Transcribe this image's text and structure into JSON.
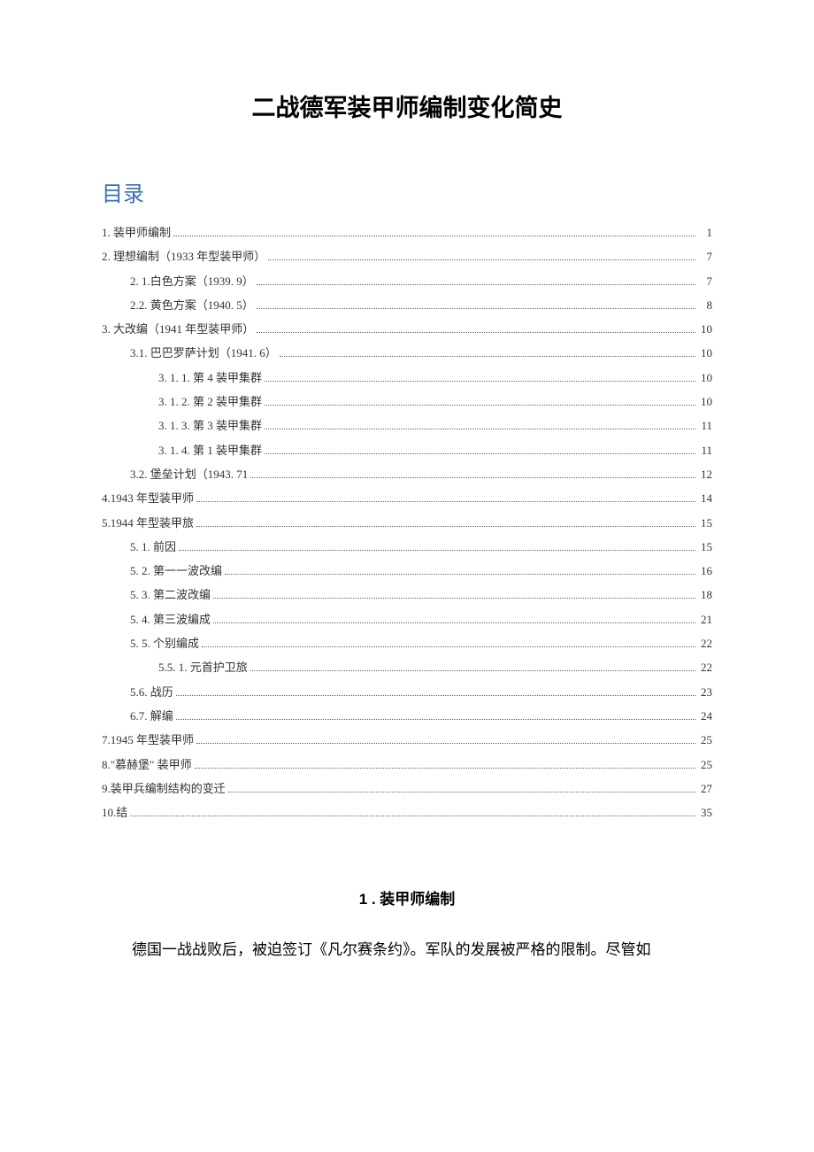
{
  "document_title": "二战德军装甲师编制变化简史",
  "toc_heading": "目录",
  "toc_entries": [
    {
      "indent": 0,
      "num": "1",
      "label": " . 装甲师编制",
      "page": "1"
    },
    {
      "indent": 0,
      "num": "2",
      "label": "  . 理想编制（1933 年型装甲师）",
      "page": "7"
    },
    {
      "indent": 1,
      "num": "2. 1.",
      "label": "  白色方案（1939. 9）",
      "page": "7"
    },
    {
      "indent": 1,
      "num": "2.",
      "label": "  2. 黄色方案（1940. 5）",
      "page": "8"
    },
    {
      "indent": 0,
      "num": "3. 大改编（1941 年型装甲师）",
      "label": "",
      "page": "10"
    },
    {
      "indent": 1,
      "num": "3.",
      "label": "  1. 巴巴罗萨计划（1941. 6）",
      "page": "10"
    },
    {
      "indent": 2,
      "num": "3. 1. 1. 第 4 装甲集群",
      "label": "",
      "page": "10"
    },
    {
      "indent": 2,
      "num": "3. 1. 2. 第 2 装甲集群",
      "label": "",
      "page": "10"
    },
    {
      "indent": 2,
      "num": "3. 1. 3. 第 3 装甲集群",
      "label": "",
      "page": "11"
    },
    {
      "indent": 2,
      "num": "3. 1. 4. 第 1 装甲集群",
      "label": "",
      "page": "11"
    },
    {
      "indent": 1,
      "num": "3.",
      "label": "  2. 堡垒计划（1943. 71",
      "page": "12"
    },
    {
      "indent": 0,
      "num": "4.",
      "label": "  1943 年型装甲师",
      "page": "14"
    },
    {
      "indent": 0,
      "num": "5.",
      "label": "  1944 年型装甲旅",
      "page": "15"
    },
    {
      "indent": 1,
      "num": "5. 1. 前因",
      "label": "",
      "page": "15"
    },
    {
      "indent": 1,
      "num": "5. 2. 第一一波改编",
      "label": "",
      "page": "16"
    },
    {
      "indent": 1,
      "num": "5. 3. 第二波改编",
      "label": "",
      "page": "18"
    },
    {
      "indent": 1,
      "num": "5. 4. 第三波编成",
      "label": "",
      "page": "21"
    },
    {
      "indent": 1,
      "num": "5. 5. 个别编成",
      "label": "",
      "page": "22"
    },
    {
      "indent": 2,
      "num": "5.",
      "label": "  5. 1. 元首护卫旅",
      "page": "22"
    },
    {
      "indent": 1,
      "num": "5.",
      "label": "  6. 战历",
      "page": "23"
    },
    {
      "indent": 1,
      "num": "6.",
      "label": "  7. 解编",
      "page": "24"
    },
    {
      "indent": 0,
      "num": "7.",
      "label": "  1945 年型装甲师",
      "page": "25"
    },
    {
      "indent": 0,
      "num": "8.",
      "label": "  \"慕赫堡\" 装甲师",
      "page": "25"
    },
    {
      "indent": 0,
      "num": "9.",
      "label": "  装甲兵编制结构的变迁",
      "page": "27"
    },
    {
      "indent": 0,
      "num": "10.",
      "label": "    结",
      "page": "35"
    }
  ],
  "section_heading": "1 . 装甲师编制",
  "body_paragraph": "德国一战战败后，被迫签订《凡尔赛条约》。军队的发展被严格的限制。尽管如"
}
